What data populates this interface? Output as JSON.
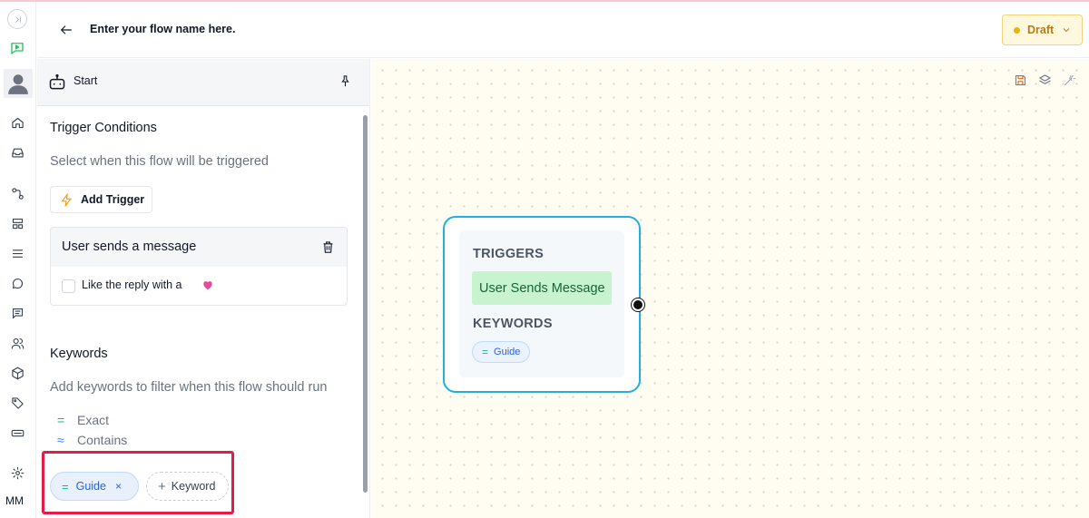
{
  "header": {
    "flow_name": "Enter your flow name here.",
    "status_label": "Draft"
  },
  "colors": {
    "node_border": "#22aee0",
    "trigger_pill": "#c7f3cf",
    "draft_badge": "#fef8df",
    "highlight": "#e11d48",
    "canvas_bg": "#fffdf2"
  },
  "sidebar": {
    "items": [
      {
        "icon": "collapse-icon"
      },
      {
        "icon": "flow-icon"
      },
      {
        "icon": "avatar-icon"
      },
      {
        "icon": "home-icon"
      },
      {
        "icon": "inbox-icon"
      },
      {
        "icon": "workflow-icon"
      },
      {
        "icon": "layout-icon"
      },
      {
        "icon": "list-icon"
      },
      {
        "icon": "chat-icon"
      },
      {
        "icon": "message-icon"
      },
      {
        "icon": "users-icon"
      },
      {
        "icon": "box-icon"
      },
      {
        "icon": "tag-icon"
      },
      {
        "icon": "keyboard-icon"
      },
      {
        "icon": "settings-icon"
      }
    ],
    "user_initials": "MM"
  },
  "panel": {
    "title": "Start",
    "trigger_section": {
      "title": "Trigger Conditions",
      "subtitle": "Select when this flow will be triggered",
      "add_button": "Add Trigger",
      "card": {
        "title": "User sends a message",
        "checkbox_label": "Like the reply with a",
        "checkbox_checked": false
      }
    },
    "keywords_section": {
      "title": "Keywords",
      "subtitle": "Add keywords to filter when this flow should run",
      "match_types": [
        {
          "symbol": "=",
          "label": "Exact"
        },
        {
          "symbol": "≈",
          "label": "Contains"
        }
      ],
      "keywords": [
        {
          "symbol": "=",
          "label": "Guide",
          "remove": "×"
        }
      ],
      "add_keyword": "Keyword",
      "add_symbol": "+"
    }
  },
  "canvas": {
    "node": {
      "triggers_label": "TRIGGERS",
      "trigger_value": "User Sends Message",
      "keywords_label": "KEYWORDS",
      "keyword": {
        "symbol": "=",
        "label": "Guide"
      }
    }
  }
}
